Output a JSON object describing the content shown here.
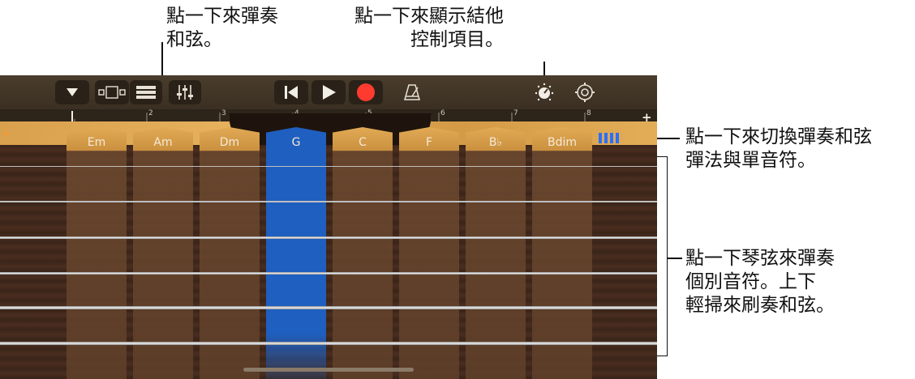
{
  "callouts": {
    "strum_chords": "點一下來彈奏\n和弦。",
    "guitar_controls": "點一下來顯示結他\n　　　控制項目。",
    "switch_mode": "點一下來切換彈奏和弦\n彈法與單音符。",
    "play_strings": "點一下琴弦來彈奏\n個別音符。上下\n輕掃來刷奏和弦。"
  },
  "ruler": {
    "marks": [
      "2",
      "3",
      "4",
      "5",
      "6",
      "7",
      "8"
    ],
    "add": "+"
  },
  "chords": [
    {
      "label": "Em",
      "selected": false
    },
    {
      "label": "Am",
      "selected": false
    },
    {
      "label": "Dm",
      "selected": false
    },
    {
      "label": "G",
      "selected": true
    },
    {
      "label": "C",
      "selected": false
    },
    {
      "label": "F",
      "selected": false
    },
    {
      "label": "B♭",
      "selected": false
    },
    {
      "label": "Bdim",
      "selected": false
    }
  ],
  "colors": {
    "record": "#ff3b30",
    "selected_chord": "#1f5fc0",
    "chord_strip": "#5a3c28",
    "mode_icon": "#2a6fff"
  },
  "icons": {
    "browser": "triangle-down-icon",
    "views": "track-view-icon",
    "tracks": "tracks-icon",
    "mixer": "mixer-icon",
    "rewind": "go-to-start-icon",
    "play": "play-icon",
    "record": "record-icon",
    "metronome": "metronome-icon",
    "guitar_controls": "knob-icon",
    "settings": "gear-icon",
    "mode": "chord-strip-icon"
  }
}
